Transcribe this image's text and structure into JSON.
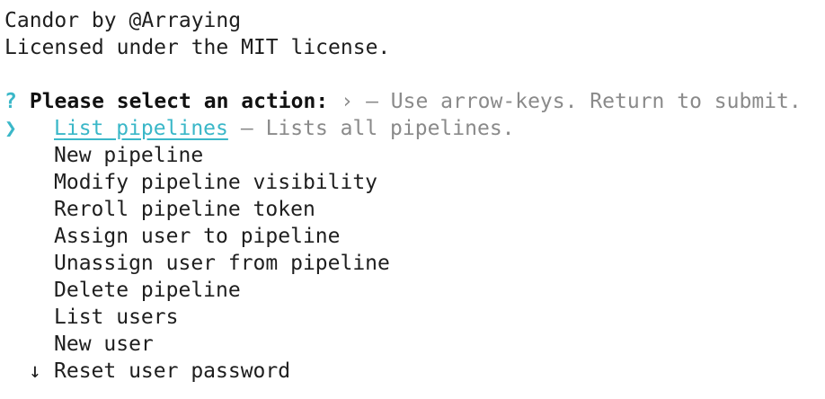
{
  "header": {
    "line1": "Candor by @Arraying",
    "line2": "Licensed under the MIT license."
  },
  "prompt": {
    "symbol": "?",
    "message": "Please select an action:",
    "separator": "›",
    "hint": "– Use arrow-keys. Return to submit."
  },
  "menu": {
    "pointer": "❯",
    "selected": {
      "label": "List pipelines",
      "description": "– Lists all pipelines."
    },
    "items": [
      "New pipeline",
      "Modify pipeline visibility",
      "Reroll pipeline token",
      "Assign user to pipeline",
      "Unassign user from pipeline",
      "Delete pipeline",
      "List users",
      "New user"
    ],
    "more_indicator": "↓",
    "last_item": "Reset user password"
  },
  "colors": {
    "accent": "#3ab7c8",
    "text": "#1e1e1e",
    "dim": "#8a8a8a",
    "background": "#ffffff"
  }
}
